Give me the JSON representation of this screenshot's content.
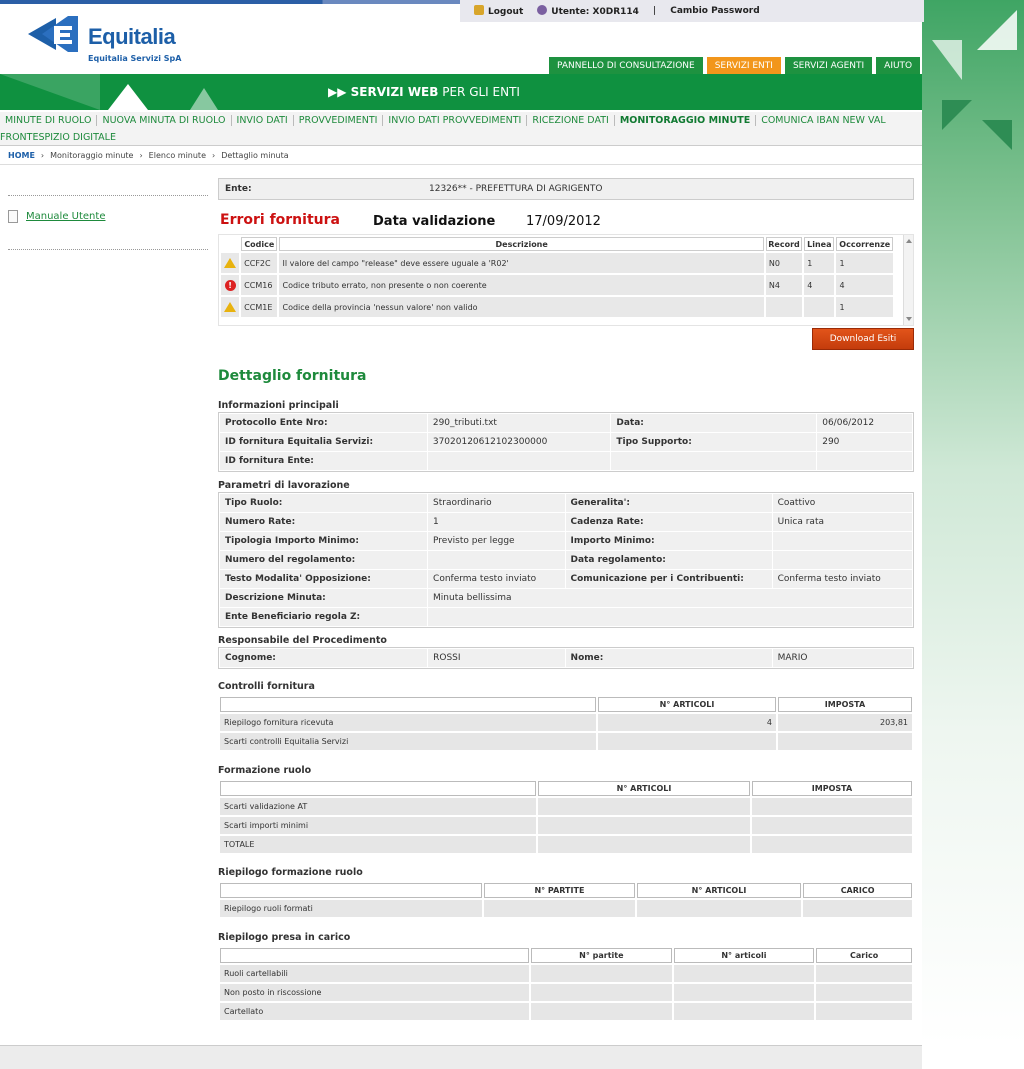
{
  "header": {
    "logo_name": "Equitalia",
    "logo_sub": "Equitalia Servizi SpA",
    "logout_label": "Logout",
    "user_label": "Utente: X0DR114",
    "separator": "|",
    "change_password_label": "Cambio Password"
  },
  "top_tabs": [
    "PANNELLO DI CONSULTAZIONE",
    "SERVIZI ENTI",
    "SERVIZI AGENTI",
    "AIUTO"
  ],
  "banner": {
    "title_bold": "SERVIZI WEB",
    "title_light": " PER GLI ENTI"
  },
  "main_menu": {
    "row1": [
      "MINUTE DI RUOLO",
      "NUOVA MINUTA DI RUOLO",
      "INVIO DATI",
      "PROVVEDIMENTI",
      "INVIO DATI PROVVEDIMENTI",
      "RICEZIONE DATI",
      "MONITORAGGIO MINUTE",
      "COMUNICA IBAN NEW VAL"
    ],
    "row2": [
      "FRONTESPIZIO DIGITALE"
    ],
    "active": "MONITORAGGIO MINUTE"
  },
  "breadcrumb": [
    "HOME",
    "Monitoraggio minute",
    "Elenco minute",
    "Dettaglio minuta"
  ],
  "sidebar": {
    "manual_label": "Manuale Utente"
  },
  "ente": {
    "label": "Ente:",
    "value": "12326** - PREFETTURA DI AGRIGENTO"
  },
  "errori": {
    "title": "Errori fornitura",
    "data_label": "Data validazione",
    "data_value": "17/09/2012",
    "headers": [
      "Codice",
      "Descrizione",
      "Record",
      "Linea",
      "Occorrenze"
    ],
    "rows": [
      {
        "type": "warning",
        "codice": "CCF2C",
        "descrizione": "Il valore del campo \"release\" deve essere uguale a 'R02'",
        "record": "N0",
        "linea": "1",
        "occorrenze": "1"
      },
      {
        "type": "error",
        "codice": "CCM16",
        "descrizione": "Codice tributo errato, non presente o non coerente",
        "record": "N4",
        "linea": "4",
        "occorrenze": "4"
      },
      {
        "type": "warning",
        "codice": "CCM1E",
        "descrizione": "Codice della provincia 'nessun valore' non valido",
        "record": "",
        "linea": "",
        "occorrenze": "1"
      }
    ],
    "download_label": "Download Esiti"
  },
  "dettaglio": {
    "title": "Dettaglio fornitura",
    "info_title": "Informazioni principali",
    "info": [
      [
        "Protocollo Ente Nro:",
        "290_tributi.txt",
        "Data:",
        "06/06/2012"
      ],
      [
        "ID fornitura Equitalia Servizi:",
        "37020120612102300000",
        "Tipo Supporto:",
        "290"
      ],
      [
        "ID fornitura Ente:",
        "",
        "",
        ""
      ]
    ],
    "param_title": "Parametri di lavorazione",
    "params": [
      [
        "Tipo Ruolo:",
        "Straordinario",
        "Generalita':",
        "Coattivo"
      ],
      [
        "Numero Rate:",
        "1",
        "Cadenza Rate:",
        "Unica rata"
      ],
      [
        "Tipologia Importo Minimo:",
        "Previsto per legge",
        "Importo Minimo:",
        ""
      ],
      [
        "Numero del regolamento:",
        "",
        "Data regolamento:",
        ""
      ],
      [
        "Testo Modalita' Opposizione:",
        "Conferma testo inviato",
        "Comunicazione per i Contribuenti:",
        "Conferma testo inviato"
      ],
      [
        "Descrizione Minuta:",
        "Minuta bellissima",
        "",
        ""
      ],
      [
        "Ente Beneficiario regola Z:",
        "",
        "",
        ""
      ]
    ],
    "resp_title": "Responsabile del Procedimento",
    "resp": [
      "Cognome:",
      "ROSSI",
      "Nome:",
      "MARIO"
    ]
  },
  "controlli": {
    "title": "Controlli fornitura",
    "headers": [
      "",
      "N° ARTICOLI",
      "IMPOSTA"
    ],
    "rows": [
      [
        "Riepilogo fornitura ricevuta",
        "4",
        "203,81"
      ],
      [
        "Scarti controlli Equitalia Servizi",
        "",
        ""
      ]
    ]
  },
  "formazione": {
    "title": "Formazione ruolo",
    "headers": [
      "",
      "N° ARTICOLI",
      "IMPOSTA"
    ],
    "rows": [
      [
        "Scarti validazione AT",
        "",
        ""
      ],
      [
        "Scarti importi minimi",
        "",
        ""
      ],
      [
        "TOTALE",
        "",
        ""
      ]
    ]
  },
  "riepilogo_formazione": {
    "title": "Riepilogo formazione ruolo",
    "headers": [
      "",
      "N° PARTITE",
      "N° ARTICOLI",
      "CARICO"
    ],
    "rows": [
      [
        "Riepilogo ruoli formati",
        "",
        "",
        ""
      ]
    ]
  },
  "presa_carico": {
    "title": "Riepilogo presa in carico",
    "headers": [
      "",
      "N° partite",
      "N° articoli",
      "Carico"
    ],
    "rows": [
      [
        "Ruoli cartellabili",
        "",
        "",
        ""
      ],
      [
        "Non posto in riscossione",
        "",
        "",
        ""
      ],
      [
        "Cartellato",
        "",
        "",
        ""
      ]
    ]
  },
  "colors": {
    "brand_green": "#0f9140",
    "active_tab": "#f2961b",
    "error_red": "#cc1111",
    "button_orange": "#d8480f"
  }
}
